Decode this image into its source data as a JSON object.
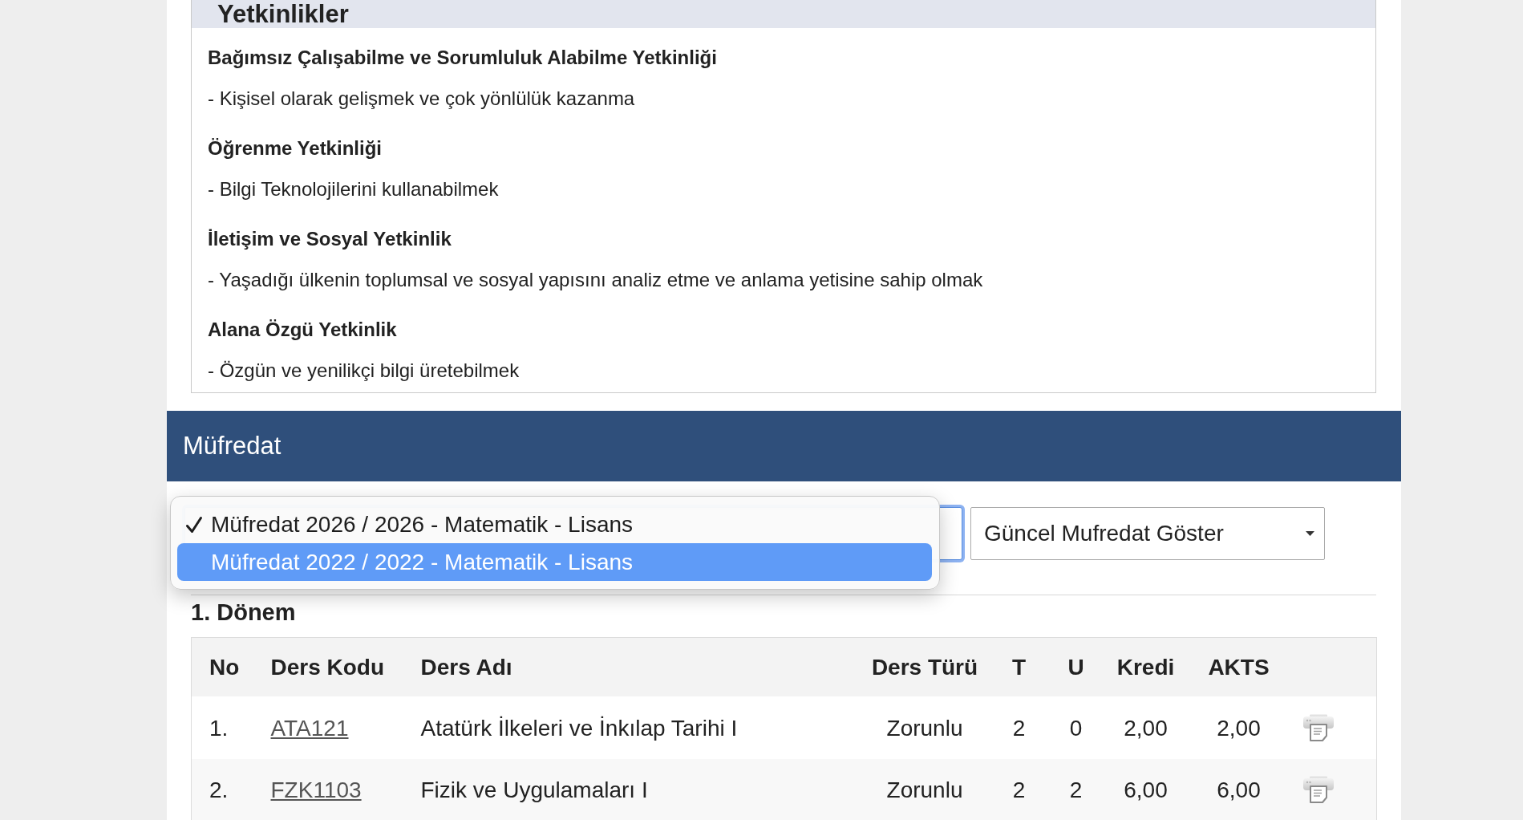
{
  "competencies": {
    "title": "Yetkinlikler",
    "groups": [
      {
        "heading": "Bağımsız Çalışabilme ve Sorumluluk Alabilme Yetkinliği",
        "items": [
          "- Kişisel olarak gelişmek ve çok yönlülük kazanma"
        ]
      },
      {
        "heading": "Öğrenme Yetkinliği",
        "items": [
          "- Bilgi Teknolojilerini kullanabilmek"
        ]
      },
      {
        "heading": "İletişim ve Sosyal Yetkinlik",
        "items": [
          "- Yaşadığı ülkenin toplumsal ve sosyal yapısını analiz etme ve anlama yetisine sahip olmak"
        ]
      },
      {
        "heading": "Alana Özgü Yetkinlik",
        "items": [
          "- Özgün ve yenilikçi bilgi üretebilmek"
        ]
      }
    ]
  },
  "curriculum": {
    "title": "Müfredat",
    "curriculum_select": {
      "open": true,
      "options": [
        {
          "label": "Müfredat 2026 / 2026 - Matematik - Lisans",
          "selected": true,
          "highlighted": false
        },
        {
          "label": "Müfredat 2022 / 2022 - Matematik - Lisans",
          "selected": false,
          "highlighted": true
        }
      ]
    },
    "view_select": {
      "value": "Güncel Mufredat Göster"
    },
    "semesters": [
      {
        "title": "1. Dönem",
        "table": {
          "columns": [
            "No",
            "Ders Kodu",
            "Ders Adı",
            "Ders Türü",
            "T",
            "U",
            "Kredi",
            "AKTS"
          ],
          "rows": [
            {
              "no": "1.",
              "code": "ATA121",
              "name": "Atatürk İlkeleri ve İnkılap Tarihi I",
              "type": "Zorunlu",
              "t": "2",
              "u": "0",
              "credit": "2,00",
              "ects": "2,00"
            },
            {
              "no": "2.",
              "code": "FZK1103",
              "name": "Fizik ve Uygulamaları I",
              "type": "Zorunlu",
              "t": "2",
              "u": "2",
              "credit": "6,00",
              "ects": "6,00"
            }
          ]
        }
      }
    ]
  }
}
